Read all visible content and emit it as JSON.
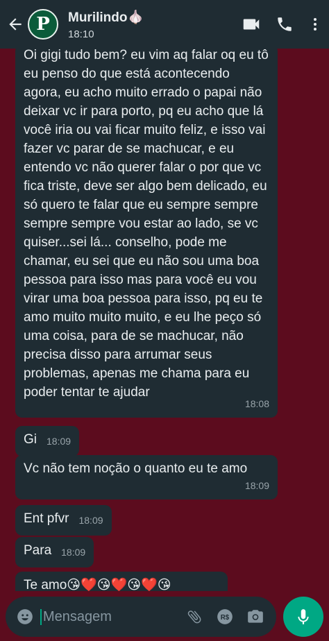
{
  "header": {
    "contact_name": "Murilindo🧄",
    "status": "18:10",
    "avatar_letter": "P"
  },
  "messages": [
    {
      "text": "Oi gigi tudo bem? eu vim aq falar oq eu tô eu penso do que está acontecendo agora, eu acho muito errado o papai não deixar vc ir para porto, pq eu acho que lá você iria ou vai ficar muito feliz, e isso vai fazer vc parar de se machucar, e eu entendo vc não querer falar o por que vc fica triste, deve ser algo bem delicado, eu só quero te falar que eu sempre sempre sempre sempre vou estar ao lado, se vc quiser...sei lá... conselho, pode me chamar, eu sei que eu não sou uma boa pessoa para isso mas para você eu vou virar uma boa pessoa para isso, pq eu te amo muito muito muito, e eu lhe peço só uma coisa, para de se machucar, não precisa disso para arrumar seus problemas, apenas me chama para eu poder tentar te ajudar",
      "time": "18:08"
    },
    {
      "text": "Gi",
      "time": "18:09"
    },
    {
      "text": "Vc não tem noção o quanto eu te amo",
      "time": "18:09"
    },
    {
      "text": "Ent pfvr",
      "time": "18:09"
    },
    {
      "text": "Para",
      "time": "18:09"
    },
    {
      "text": "Te amo😘❤️😘❤️😘❤️😘",
      "time": ""
    }
  ],
  "input": {
    "placeholder": "Mensagem"
  },
  "icons": {
    "back": "arrow-left-icon",
    "video": "video-call-icon",
    "call": "phone-icon",
    "menu": "more-vert-icon",
    "emoji": "emoji-icon",
    "attach": "paperclip-icon",
    "payment": "payment-icon",
    "camera": "camera-icon",
    "mic": "mic-icon"
  },
  "colors": {
    "header": "#1f2c33",
    "bubble": "#1f2c33",
    "accent": "#00a884",
    "wallpaper": "#5c0c1e"
  }
}
